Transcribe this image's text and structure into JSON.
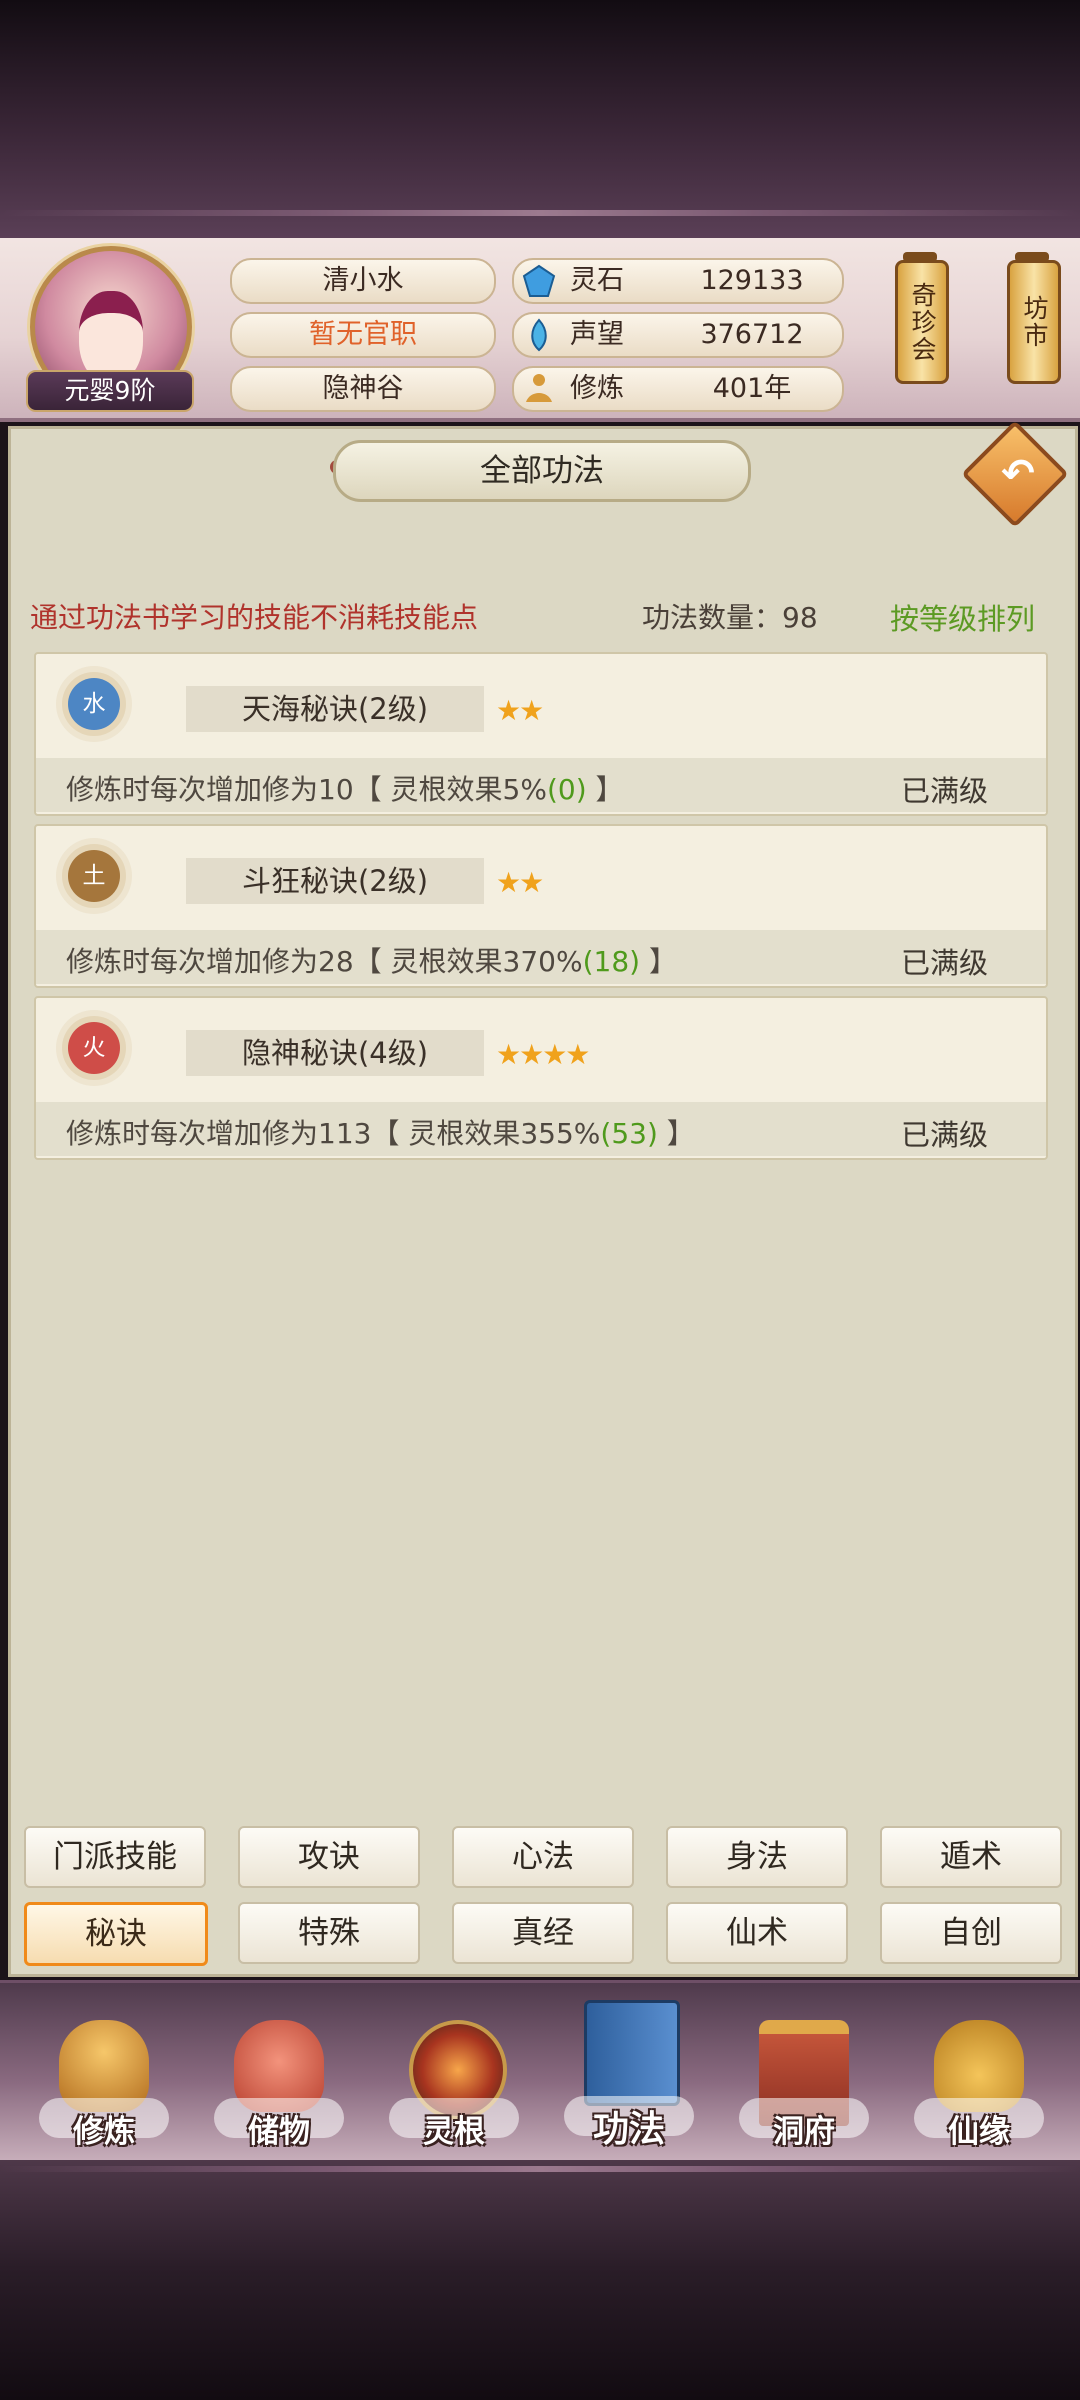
{
  "header": {
    "avatar_alt": "",
    "realm": "元婴9阶",
    "name": "清小水",
    "office": "暂无官职",
    "sect": "隐神谷",
    "stats": [
      {
        "label": "灵石",
        "value": "129133",
        "icon": "spirit-stone-icon"
      },
      {
        "label": "声望",
        "value": "376712",
        "icon": "reputation-icon"
      },
      {
        "label": "修炼",
        "value": "401年",
        "icon": "meditation-icon"
      }
    ],
    "lantern_treasure": "奇珍会",
    "lantern_market": "坊市"
  },
  "panel": {
    "title": "全部功法",
    "hint": "通过功法书学习的技能不消耗技能点",
    "count_label": "功法数量：98",
    "sort_label": "按等级排列"
  },
  "skills": [
    {
      "element": "水",
      "element_color": "#4d86c4",
      "name": "天海秘诀(2级)",
      "stars": "★★",
      "desc_main": "修炼时每次增加修为10【 灵根效果5%",
      "desc_bonus": "(0)",
      "desc_end": " 】",
      "status": "已满级"
    },
    {
      "element": "土",
      "element_color": "#a5763c",
      "name": "斗狂秘诀(2级)",
      "stars": "★★",
      "desc_main": "修炼时每次增加修为28【 灵根效果370%",
      "desc_bonus": "(18)",
      "desc_end": " 】",
      "status": "已满级"
    },
    {
      "element": "火",
      "element_color": "#cf4d48",
      "name": "隐神秘诀(4级)",
      "stars": "★★★★",
      "desc_main": "修炼时每次增加修为113【 灵根效果355%",
      "desc_bonus": "(53)",
      "desc_end": " 】",
      "status": "已满级"
    }
  ],
  "tabs": [
    "门派技能",
    "攻诀",
    "心法",
    "身法",
    "遁术",
    "秘诀",
    "特殊",
    "真经",
    "仙术",
    "自创"
  ],
  "active_tab": "秘诀",
  "nav": [
    {
      "label": "修炼",
      "icon": "cultivation-icon"
    },
    {
      "label": "储物",
      "icon": "storage-bag-icon"
    },
    {
      "label": "灵根",
      "icon": "spirit-root-icon"
    },
    {
      "label": "功法",
      "icon": "technique-book-icon"
    },
    {
      "label": "洞府",
      "icon": "cave-dwelling-icon"
    },
    {
      "label": "仙缘",
      "icon": "immortal-fate-icon"
    }
  ],
  "colors": {
    "hint_red": "#b0332c",
    "sort_green": "#5c9a23",
    "bonus_green": "#4f9a1c",
    "office_orange": "#e0622a",
    "active_tab_orange": "#f08a1a"
  }
}
